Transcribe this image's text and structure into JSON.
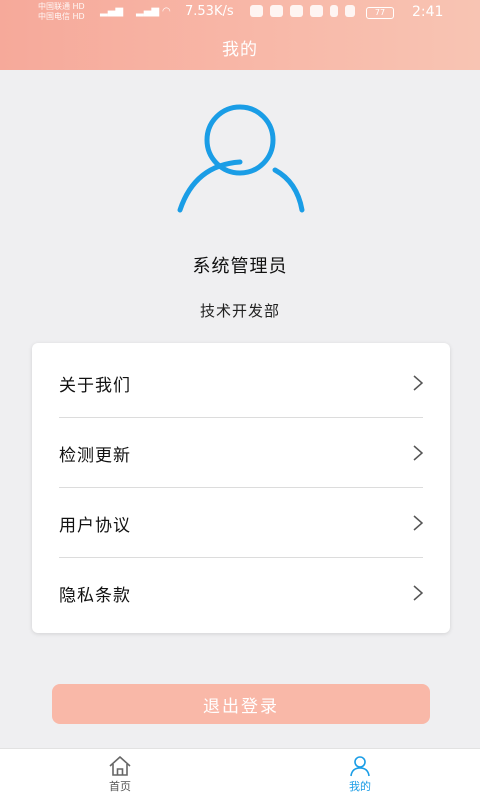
{
  "status_bar": {
    "carrier1": "中国联通 HD",
    "carrier2": "中国电信 HD",
    "net_speed": "7.53K/s",
    "battery": "77",
    "time": "2:41"
  },
  "header": {
    "title": "我的"
  },
  "profile": {
    "name": "系统管理员",
    "department": "技术开发部"
  },
  "menu": {
    "items": [
      {
        "label": "关于我们"
      },
      {
        "label": "检测更新"
      },
      {
        "label": "用户协议"
      },
      {
        "label": "隐私条款"
      }
    ]
  },
  "logout": {
    "label": "退出登录"
  },
  "tabbar": {
    "tabs": [
      {
        "label": "首页",
        "icon": "home-icon"
      },
      {
        "label": "我的",
        "icon": "user-icon"
      }
    ]
  },
  "colors": {
    "header_gradient_start": "#f6a99a",
    "accent_blue": "#1a9de6",
    "logout_button": "#f9b8a8",
    "active_tab": "#1a9de6",
    "inactive_tab": "#555555"
  }
}
